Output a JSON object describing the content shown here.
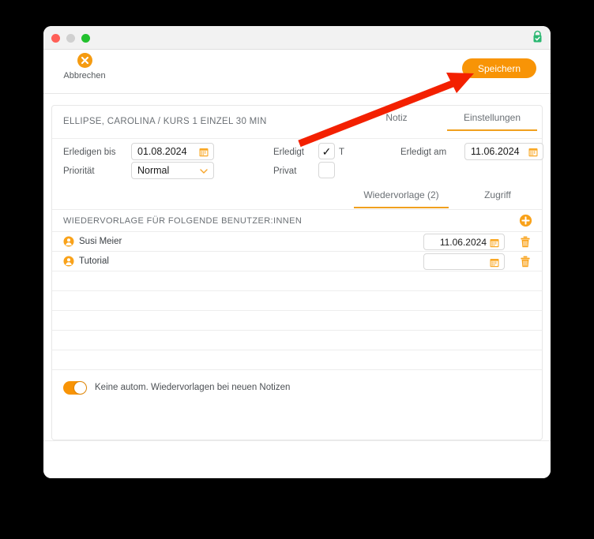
{
  "window": {
    "traffic_lights": [
      "close",
      "minimize",
      "zoom"
    ],
    "lock_icon": "secure-lock-icon"
  },
  "toolbar": {
    "cancel_label": "Abbrechen",
    "cancel_icon": "cancel-x-icon",
    "save_label": "Speichern"
  },
  "panel": {
    "record_title": "ELLIPSE, CAROLINA / KURS 1 EINZEL 30 MIN",
    "top_tabs": [
      {
        "label": "Notiz",
        "active": false
      },
      {
        "label": "Einstellungen",
        "active": true
      }
    ],
    "fields": {
      "due_label": "Erledigen bis",
      "due_value": "01.08.2024",
      "priority_label": "Priorität",
      "priority_value": "Normal",
      "priority_options": [
        "Normal"
      ],
      "done_label": "Erledigt",
      "done_checked": "✓",
      "done_suffix": "T",
      "private_label": "Privat",
      "private_checked": "",
      "done_on_label": "Erledigt am",
      "done_on_value": "11.06.2024"
    },
    "second_tabs": [
      {
        "label": "Wiedervorlage (2)",
        "active": true
      },
      {
        "label": "Zugriff",
        "active": false
      }
    ],
    "section": {
      "title": "WIEDERVORLAGE FÜR FOLGENDE BENUTZER:INNEN",
      "add_icon": "plus-circle-icon"
    },
    "rows": [
      {
        "name": "Susi Meier",
        "date": "11.06.2024"
      },
      {
        "name": "Tutorial",
        "date": ""
      },
      {
        "name": "",
        "date": null
      },
      {
        "name": "",
        "date": null
      },
      {
        "name": "",
        "date": null
      },
      {
        "name": "",
        "date": null
      },
      {
        "name": "",
        "date": null
      }
    ],
    "footer": {
      "toggle_on": true,
      "toggle_label": "Keine autom. Wiedervorlagen bei neuen Notizen"
    }
  },
  "colors": {
    "accent_orange": "#f89406",
    "tab_underline": "#f0a01e",
    "annotation_red": "#f32000",
    "lock_green": "#2cb872"
  },
  "annotation": {
    "arrow": "red-arrow-pointing-to-save-button"
  }
}
